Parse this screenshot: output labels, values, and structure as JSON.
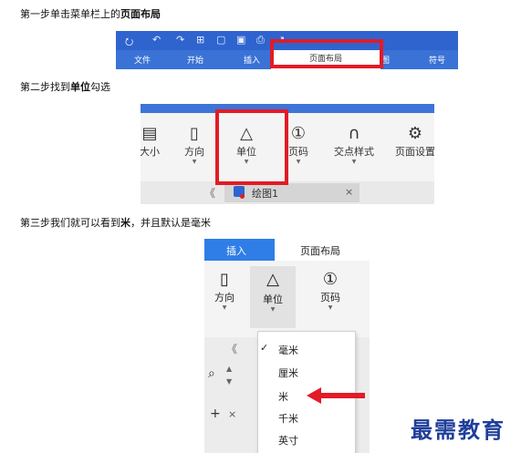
{
  "steps": {
    "step1_prefix": "第一步单击菜单栏上的",
    "step1_bold": "页面布局",
    "step2_prefix": "第二步找到",
    "step2_bold": "单位",
    "step2_suffix": "勾选",
    "step3_prefix": "第三步我们就可以看到",
    "step3_bold": "米",
    "step3_suffix": "，并且默认是毫米"
  },
  "panel1": {
    "tabs": [
      "文件",
      "开始",
      "插入",
      "页面布局",
      "视图",
      "符号"
    ],
    "active_tab": "页面布局"
  },
  "panel2": {
    "tools": [
      "大小",
      "方向",
      "单位",
      "页码",
      "交点样式",
      "页面设置"
    ],
    "doc_tab": "绘图1",
    "close_glyph": "×",
    "collapse_glyph": "《"
  },
  "panel3": {
    "tabs": [
      "插入",
      "页面布局"
    ],
    "tools": [
      "方向",
      "单位",
      "页码"
    ],
    "menu_items": [
      "毫米",
      "厘米",
      "米",
      "千米",
      "英寸"
    ],
    "checked_item": "毫米",
    "side_plus": "+",
    "side_x": "×",
    "collapse_glyph": "《"
  },
  "watermark": "最需教育",
  "colors": {
    "accent_blue": "#2f64cf",
    "highlight_red": "#e21b26",
    "watermark": "#1f3e9a"
  }
}
